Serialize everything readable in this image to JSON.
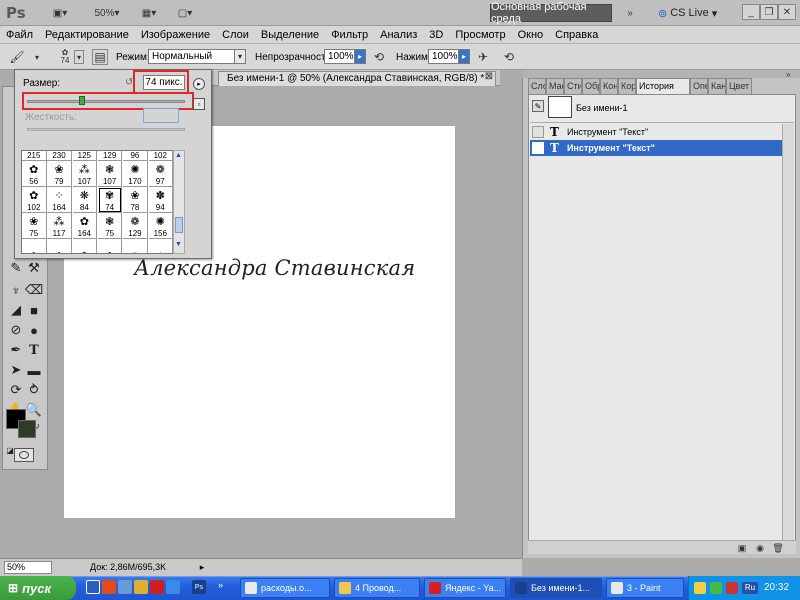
{
  "app": {
    "logo": "Ps",
    "zoom": "50%",
    "workspace": "Основная рабочая среда",
    "cs_live": "CS Live"
  },
  "menu": [
    "Файл",
    "Редактирование",
    "Изображение",
    "Слои",
    "Выделение",
    "Фильтр",
    "Анализ",
    "3D",
    "Просмотр",
    "Окно",
    "Справка"
  ],
  "options": {
    "brush_size": "74",
    "mode_label": "Режим:",
    "mode_value": "Нормальный",
    "opacity_label": "Непрозрачность:",
    "opacity_value": "100%",
    "pressure_label": "Нажим:",
    "pressure_value": "100%"
  },
  "document": {
    "tab_title": "Без имени-1 @ 50% (Александра Ставинская, RGB/8) *",
    "canvas_text": "Александра Ставинская"
  },
  "brush_picker": {
    "size_label": "Размер:",
    "size_value": "74 пикс.",
    "size_percent": 0.33,
    "hardness_label": "Жесткость:",
    "grid": [
      [
        "215",
        "230",
        "125",
        "129",
        "96",
        "102"
      ],
      [
        "56",
        "79",
        "107",
        "107",
        "170",
        "97"
      ],
      [
        "102",
        "164",
        "84",
        "74",
        "78",
        "94"
      ],
      [
        "75",
        "117",
        "164",
        "75",
        "129",
        "156"
      ]
    ],
    "glyphs": [
      [
        "",
        "",
        "",
        "",
        "",
        ""
      ],
      [
        "✿",
        "❀",
        "⁂",
        "❃",
        "✺",
        "❁"
      ],
      [
        "✿",
        "⁘",
        "❋",
        "✾",
        "❀",
        "✽"
      ],
      [
        "❀",
        "⁂",
        "✿",
        "❃",
        "❁",
        "✺"
      ],
      [
        "✿",
        "❀",
        "✤",
        "✱",
        "✹",
        "✷"
      ]
    ]
  },
  "panels": {
    "tabs": [
      "Сло",
      "Мас",
      "Сти",
      "Обр",
      "Кон",
      "Кор",
      "История",
      "Опе",
      "Кан",
      "Цвет"
    ],
    "active_tab": "История",
    "snapshot": "Без имени-1",
    "history": [
      "Инструмент \"Текст\"",
      "Инструмент \"Текст\""
    ]
  },
  "status": {
    "zoom": "50%",
    "doc_info": "Док: 2,86M/695,3K"
  },
  "taskbar": {
    "start": "пуск",
    "tasks": [
      "расходы.о...",
      "4 Провод...",
      "Яндекс - Ya...",
      "Без имени-1...",
      "3 - Paint"
    ],
    "clock": "20:32",
    "lang": "Ru"
  },
  "colors": {
    "foreground": "#000000",
    "background": "#2e3b26",
    "highlight": "#e02828",
    "history_selected": "#3169c6"
  }
}
